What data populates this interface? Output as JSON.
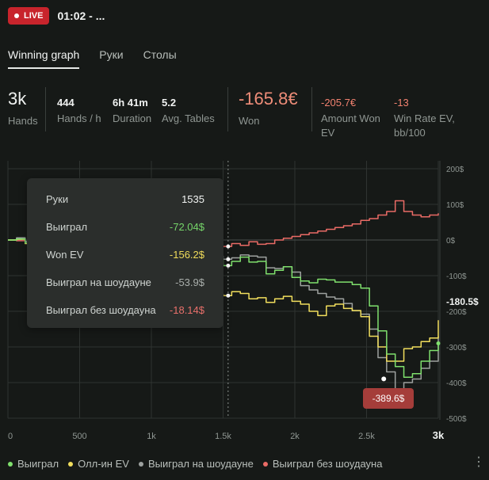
{
  "header": {
    "live_label": "LIVE",
    "time": "01:02 - ..."
  },
  "tabs": [
    {
      "label": "Winning graph",
      "active": true
    },
    {
      "label": "Руки",
      "active": false
    },
    {
      "label": "Столы",
      "active": false
    }
  ],
  "stats": {
    "hands": {
      "value": "3k",
      "label": "Hands"
    },
    "hands_per_hour": {
      "value": "444",
      "label": "Hands / h"
    },
    "duration": {
      "value": "6h 41m",
      "label": "Duration"
    },
    "avg_tables": {
      "value": "5.2",
      "label": "Avg. Tables"
    },
    "won": {
      "value": "-165.8€",
      "label": "Won"
    },
    "amount_won_ev": {
      "value": "-205.7€",
      "label_line1": "Amount Won",
      "label_line2": "EV"
    },
    "win_rate_ev": {
      "value": "-13",
      "label_line1": "Win Rate EV,",
      "label_line2": "bb/100"
    }
  },
  "tooltip": {
    "rows": [
      {
        "key": "Руки",
        "value": "1535",
        "color": "#f0f2f1"
      },
      {
        "key": "Выиграл",
        "value": "-72.04$",
        "color": "#76d66a"
      },
      {
        "key": "Won EV",
        "value": "-156.2$",
        "color": "#f0dc5a"
      },
      {
        "key": "Выиграл на шоудауне",
        "value": "-53.9$",
        "color": "#a9aeab"
      },
      {
        "key": "Выиграл без шоудауна",
        "value": "-18.14$",
        "color": "#e9706b"
      }
    ]
  },
  "colors": {
    "won": "#7fe06d",
    "allin_ev": "#f1de5d",
    "showdown": "#9da19f",
    "non_showdown": "#ea6b66",
    "grid": "#2f3431"
  },
  "chart_data": {
    "type": "line",
    "xlim": [
      0,
      3000
    ],
    "ylim": [
      -500,
      200
    ],
    "x_ticks": [
      0,
      500,
      1000,
      1500,
      2000,
      2500,
      3000
    ],
    "x_tick_labels": [
      "0",
      "500",
      "1k",
      "1.5k",
      "2k",
      "2.5k",
      "3k"
    ],
    "y_ticks": [
      200,
      100,
      0,
      -100,
      -200,
      -300,
      -400,
      -500
    ],
    "y_tick_labels": [
      "200$",
      "100$",
      "0$",
      "-100$",
      "-200$",
      "-300$",
      "-400$",
      "-500$"
    ],
    "hover_x": 1535,
    "end_value_label": "-180.5$",
    "min_value_label": "-389.6$",
    "min_point": {
      "x": 2620,
      "y": -389.6
    },
    "grid": true,
    "legend_position": "bottom-left",
    "series": [
      {
        "name": "Выиграл",
        "color": "#7fe06d",
        "x": [
          0,
          60,
          120,
          180,
          240,
          300,
          360,
          420,
          480,
          540,
          600,
          660,
          720,
          780,
          840,
          900,
          960,
          1020,
          1080,
          1140,
          1200,
          1260,
          1320,
          1380,
          1440,
          1500,
          1560,
          1620,
          1680,
          1740,
          1800,
          1860,
          1920,
          1980,
          2040,
          2100,
          2160,
          2220,
          2280,
          2340,
          2400,
          2460,
          2520,
          2580,
          2640,
          2700,
          2760,
          2820,
          2880,
          2940,
          3000
        ],
        "y": [
          0,
          3,
          -8,
          2,
          -5,
          5,
          -10,
          2,
          -6,
          1,
          -12,
          -4,
          -9,
          -2,
          -15,
          -8,
          -18,
          -10,
          -20,
          -14,
          -25,
          -28,
          -35,
          -40,
          -55,
          -72,
          -60,
          -48,
          -62,
          -60,
          -95,
          -85,
          -75,
          -105,
          -115,
          -120,
          -110,
          -112,
          -118,
          -118,
          -125,
          -135,
          -185,
          -255,
          -320,
          -355,
          -385,
          -375,
          -340,
          -310,
          -290
        ]
      },
      {
        "name": "Олл-ин EV",
        "color": "#f1de5d",
        "x": [
          0,
          60,
          120,
          180,
          240,
          300,
          360,
          420,
          480,
          540,
          600,
          660,
          720,
          780,
          840,
          900,
          960,
          1020,
          1080,
          1140,
          1200,
          1260,
          1320,
          1380,
          1440,
          1500,
          1560,
          1620,
          1680,
          1740,
          1800,
          1860,
          1920,
          1980,
          2040,
          2100,
          2160,
          2220,
          2280,
          2340,
          2400,
          2460,
          2520,
          2580,
          2640,
          2700,
          2760,
          2820,
          2880,
          2940,
          3000
        ],
        "y": [
          0,
          2,
          -10,
          1,
          -8,
          -2,
          -15,
          -6,
          -20,
          -14,
          -30,
          -40,
          -55,
          -62,
          -70,
          -82,
          -90,
          -100,
          -108,
          -118,
          -125,
          -132,
          -140,
          -148,
          -152,
          -156,
          -145,
          -150,
          -165,
          -162,
          -175,
          -165,
          -158,
          -172,
          -180,
          -200,
          -212,
          -185,
          -180,
          -192,
          -198,
          -215,
          -270,
          -300,
          -340,
          -340,
          -305,
          -300,
          -285,
          -275,
          -225
        ]
      },
      {
        "name": "Выиграл на шоудауне",
        "color": "#9da19f",
        "x": [
          0,
          60,
          120,
          180,
          240,
          300,
          360,
          420,
          480,
          540,
          600,
          660,
          720,
          780,
          840,
          900,
          960,
          1020,
          1080,
          1140,
          1200,
          1260,
          1320,
          1380,
          1440,
          1500,
          1560,
          1620,
          1680,
          1740,
          1800,
          1860,
          1920,
          1980,
          2040,
          2100,
          2160,
          2220,
          2280,
          2340,
          2400,
          2460,
          2520,
          2580,
          2640,
          2700,
          2760,
          2820,
          2880,
          2940,
          3000
        ],
        "y": [
          0,
          6,
          -4,
          8,
          -2,
          14,
          0,
          10,
          -4,
          12,
          -6,
          4,
          -2,
          10,
          -10,
          2,
          -14,
          -4,
          -18,
          -8,
          -20,
          -22,
          -28,
          -32,
          -45,
          -54,
          -50,
          -42,
          -45,
          -48,
          -78,
          -80,
          -75,
          -90,
          -128,
          -140,
          -150,
          -160,
          -165,
          -178,
          -198,
          -208,
          -250,
          -330,
          -370,
          -420,
          -400,
          -390,
          -360,
          -340,
          -270
        ]
      },
      {
        "name": "Выиграл без шоудауна",
        "color": "#ea6b66",
        "x": [
          0,
          60,
          120,
          180,
          240,
          300,
          360,
          420,
          480,
          540,
          600,
          660,
          720,
          780,
          840,
          900,
          960,
          1020,
          1080,
          1140,
          1200,
          1260,
          1320,
          1380,
          1440,
          1500,
          1560,
          1620,
          1680,
          1740,
          1800,
          1860,
          1920,
          1980,
          2040,
          2100,
          2160,
          2220,
          2280,
          2340,
          2400,
          2460,
          2520,
          2580,
          2640,
          2700,
          2760,
          2820,
          2880,
          2940,
          3000
        ],
        "y": [
          0,
          -2,
          -4,
          -6,
          -3,
          -8,
          -10,
          -5,
          -12,
          -8,
          -15,
          -12,
          -18,
          -14,
          -20,
          -16,
          -18,
          -15,
          -17,
          -16,
          -20,
          -22,
          -20,
          -18,
          -20,
          -18,
          -10,
          -15,
          -5,
          -12,
          -10,
          0,
          5,
          10,
          15,
          20,
          25,
          30,
          35,
          40,
          45,
          55,
          60,
          70,
          80,
          110,
          80,
          70,
          65,
          70,
          75
        ]
      }
    ]
  },
  "legend": [
    {
      "label": "Выиграл",
      "color": "#7fe06d"
    },
    {
      "label": "Олл-ин EV",
      "color": "#f1de5d"
    },
    {
      "label": "Выиграл на шоудауне",
      "color": "#9da19f"
    },
    {
      "label": "Выиграл без шоудауна",
      "color": "#ea6b66"
    }
  ],
  "more_icon": "more-vertical-icon"
}
